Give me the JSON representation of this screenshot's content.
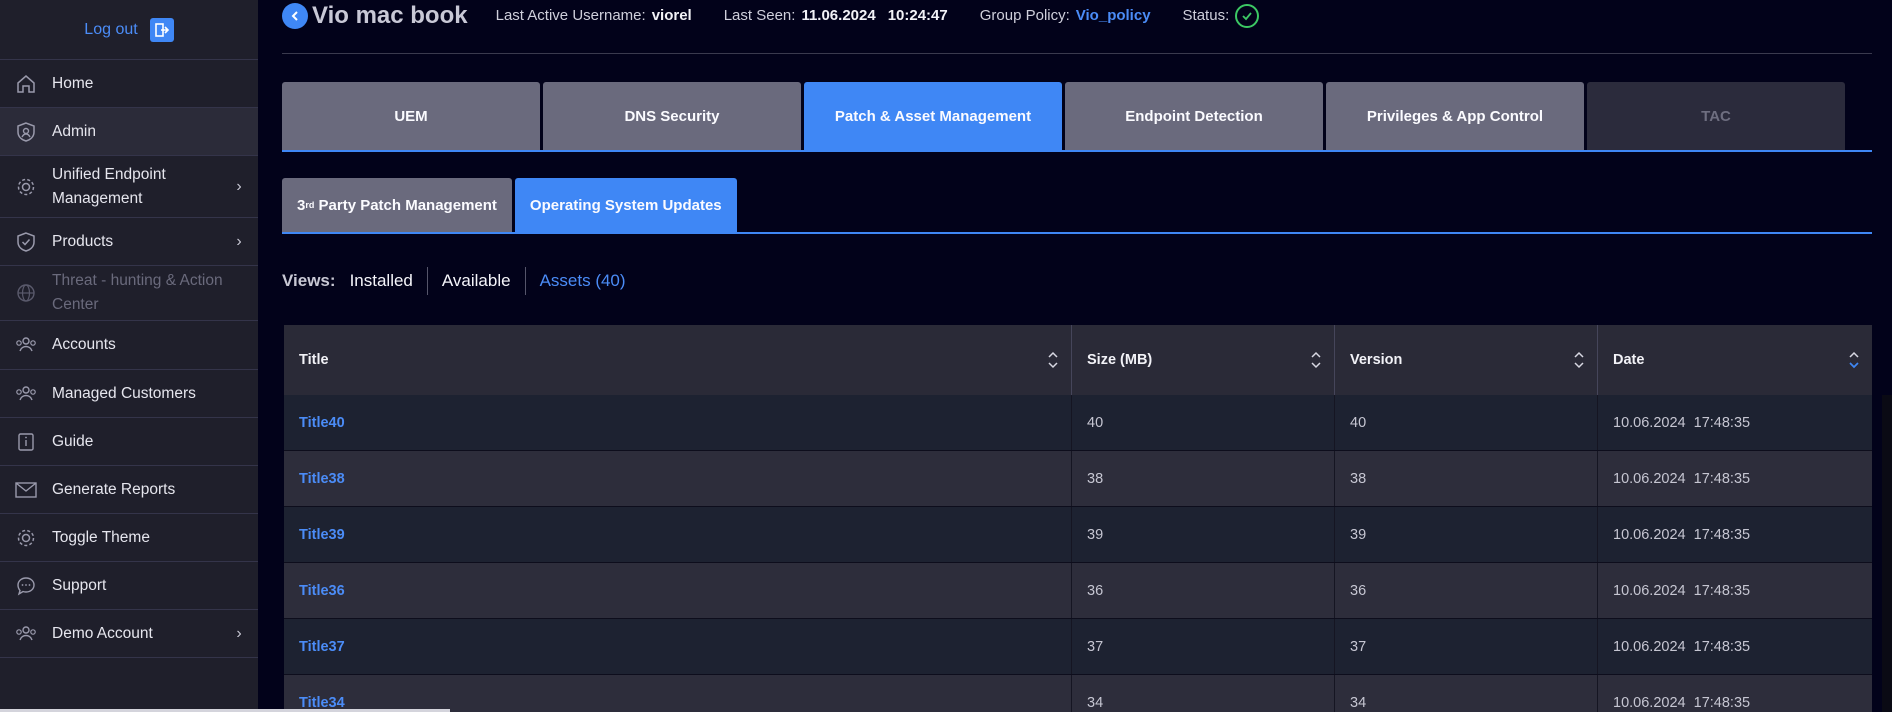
{
  "sidebar": {
    "logout_label": "Log out",
    "items": [
      {
        "label": "Home",
        "icon": "home-icon",
        "state": "normal",
        "chevron": false
      },
      {
        "label": "Admin",
        "icon": "admin-shield-icon",
        "state": "active",
        "chevron": false
      },
      {
        "label": "Unified Endpoint Management",
        "icon": "gear-icon",
        "state": "normal",
        "chevron": true
      },
      {
        "label": "Products",
        "icon": "shield-icon",
        "state": "normal",
        "chevron": true
      },
      {
        "label": "Threat - hunting & Action Center",
        "icon": "globe-icon",
        "state": "disabled",
        "chevron": false
      },
      {
        "label": "Accounts",
        "icon": "users-icon",
        "state": "normal",
        "chevron": false
      },
      {
        "label": "Managed Customers",
        "icon": "users-icon",
        "state": "normal",
        "chevron": false
      },
      {
        "label": "Guide",
        "icon": "info-icon",
        "state": "normal",
        "chevron": false
      },
      {
        "label": "Generate Reports",
        "icon": "mail-icon",
        "state": "normal",
        "chevron": false
      },
      {
        "label": "Toggle Theme",
        "icon": "gear-icon",
        "state": "normal",
        "chevron": false
      },
      {
        "label": "Support",
        "icon": "chat-icon",
        "state": "normal",
        "chevron": false
      },
      {
        "label": "Demo Account",
        "icon": "users-icon",
        "state": "normal",
        "chevron": true
      }
    ]
  },
  "header": {
    "device_name": "Vio mac book",
    "last_active_label": "Last Active Username:",
    "last_active_value": "viorel",
    "last_seen_label": "Last Seen:",
    "last_seen_date": "11.06.2024",
    "last_seen_time": "10:24:47",
    "group_policy_label": "Group Policy:",
    "group_policy_value": "Vio_policy",
    "status_label": "Status:"
  },
  "main_tabs": [
    {
      "label": "UEM",
      "state": "normal"
    },
    {
      "label": "DNS Security",
      "state": "normal"
    },
    {
      "label": "Patch & Asset Management",
      "state": "active"
    },
    {
      "label": "Endpoint Detection",
      "state": "normal"
    },
    {
      "label": "Privileges & App Control",
      "state": "normal"
    },
    {
      "label": "TAC",
      "state": "disabled"
    }
  ],
  "sub_tabs": {
    "third_party_prefix": "3",
    "third_party_sup": "rd",
    "third_party_rest": " Party Patch Management",
    "os_updates": "Operating System Updates"
  },
  "views": {
    "label": "Views:",
    "options": [
      "Installed",
      "Available",
      "Assets (40)"
    ],
    "active_index": 2
  },
  "table": {
    "columns": [
      "Title",
      "Size (MB)",
      "Version",
      "Date"
    ],
    "rows": [
      {
        "title": "Title40",
        "size": "40",
        "version": "40",
        "date": "10.06.2024  17:48:35"
      },
      {
        "title": "Title38",
        "size": "38",
        "version": "38",
        "date": "10.06.2024  17:48:35"
      },
      {
        "title": "Title39",
        "size": "39",
        "version": "39",
        "date": "10.06.2024  17:48:35"
      },
      {
        "title": "Title36",
        "size": "36",
        "version": "36",
        "date": "10.06.2024  17:48:35"
      },
      {
        "title": "Title37",
        "size": "37",
        "version": "37",
        "date": "10.06.2024  17:48:35"
      },
      {
        "title": "Title34",
        "size": "34",
        "version": "34",
        "date": "10.06.2024  17:48:35"
      }
    ]
  },
  "colors": {
    "accent": "#3f87f5",
    "link": "#4b8cf7",
    "status_ok": "#3cc864",
    "background": "#02021a",
    "sidebar": "#1f1f2b"
  }
}
